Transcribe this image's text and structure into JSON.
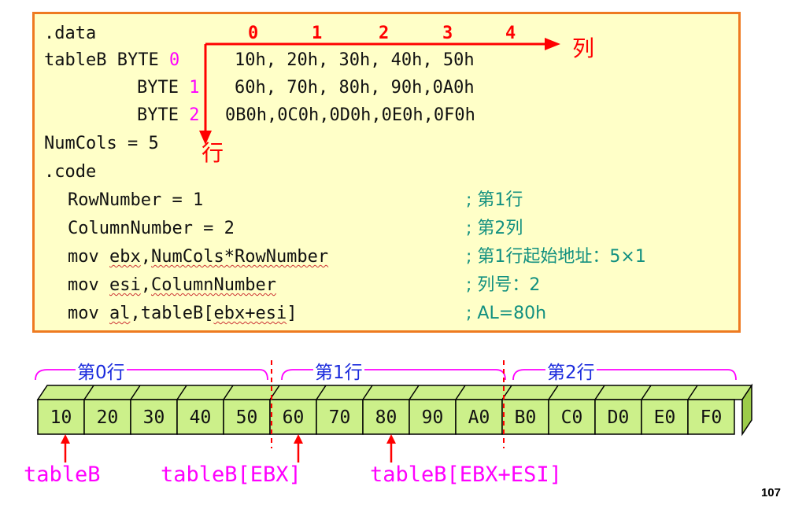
{
  "code": {
    "data_directive": ".data",
    "col_indices": [
      "0",
      "1",
      "2",
      "3",
      "4"
    ],
    "col_axis_label": "列",
    "row_axis_label": "行",
    "rows": [
      {
        "prefix": "tableB BYTE",
        "index": "0",
        "values": "10h, 20h, 30h, 40h, 50h"
      },
      {
        "prefix": "BYTE",
        "index": "1",
        "values": "60h, 70h, 80h, 90h,0A0h"
      },
      {
        "prefix": "BYTE",
        "index": "2",
        "values": "0B0h,0C0h,0D0h,0E0h,0F0h"
      }
    ],
    "numcols_line": "NumCols = 5",
    "code_directive": ".code",
    "instructions": [
      {
        "text": "RowNumber = 1",
        "comment": "; 第1行"
      },
      {
        "text": "ColumnNumber = 2",
        "comment": "; 第2列"
      },
      {
        "op": "mov",
        "arg1": "ebx",
        "arg2": "NumCols*RowNumber",
        "comment": "; 第1行起始地址：5×1"
      },
      {
        "op": "mov",
        "arg1": "esi",
        "arg2": "ColumnNumber",
        "comment": "; 列号：2"
      },
      {
        "op": "mov",
        "arg1": "al",
        "arg2a": "tableB[",
        "arg2b": "ebx+esi",
        "arg2c": "]",
        "comment": "; AL=80h"
      }
    ]
  },
  "memory": {
    "row_labels": [
      "第0行",
      "第1行",
      "第2行"
    ],
    "cells": [
      "10",
      "20",
      "30",
      "40",
      "50",
      "60",
      "70",
      "80",
      "90",
      "A0",
      "B0",
      "C0",
      "D0",
      "E0",
      "F0"
    ],
    "cell_fill": "#ccf08a",
    "pointer_labels": [
      "tableB",
      "tableB[EBX]",
      "tableB[EBX+ESI]"
    ]
  },
  "colors": {
    "box_border": "#ee7a21",
    "box_fill": "#ffffc8",
    "accent": "#ff00ff",
    "comment": "#129080",
    "arrow": "#ff0000"
  },
  "page_number": "107"
}
